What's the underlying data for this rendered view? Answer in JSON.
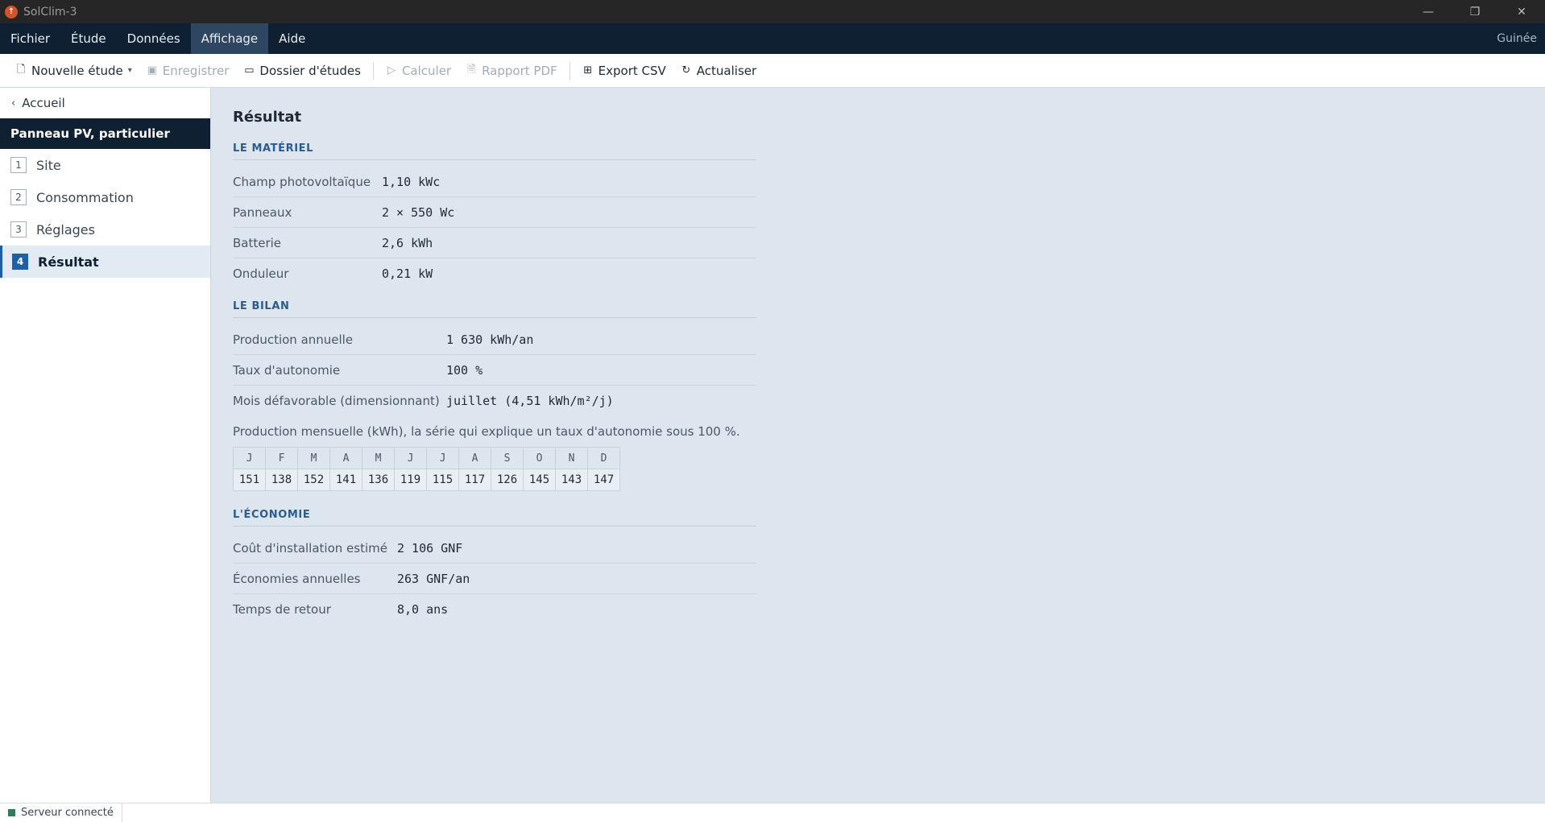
{
  "window": {
    "title": "SolClim-3",
    "icon": "sun-icon"
  },
  "menu": {
    "items": [
      "Fichier",
      "Étude",
      "Données",
      "Affichage",
      "Aide"
    ],
    "active": "Affichage",
    "region": "Guinée"
  },
  "toolbar": {
    "new_study": "Nouvelle étude",
    "save": "Enregistrer",
    "studies_folder": "Dossier d'études",
    "compute": "Calculer",
    "pdf_report": "Rapport PDF",
    "export_csv": "Export CSV",
    "refresh": "Actualiser"
  },
  "sidebar": {
    "back": "Accueil",
    "study_title": "Panneau PV, particulier",
    "steps": [
      {
        "num": "1",
        "label": "Site"
      },
      {
        "num": "2",
        "label": "Consommation"
      },
      {
        "num": "3",
        "label": "Réglages"
      },
      {
        "num": "4",
        "label": "Résultat"
      }
    ],
    "active_step": "4"
  },
  "main": {
    "title": "Résultat",
    "materiel": {
      "heading": "LE MATÉRIEL",
      "rows": [
        {
          "label": "Champ photovoltaïque",
          "value": "1,10 kWc"
        },
        {
          "label": "Panneaux",
          "value": "2 × 550 Wc"
        },
        {
          "label": "Batterie",
          "value": "2,6 kWh"
        },
        {
          "label": "Onduleur",
          "value": "0,21 kW"
        }
      ]
    },
    "bilan": {
      "heading": "LE BILAN",
      "rows": [
        {
          "label": "Production annuelle",
          "value": "1 630 kWh/an"
        },
        {
          "label": "Taux d'autonomie",
          "value": "100 %"
        },
        {
          "label": "Mois défavorable (dimensionnant)",
          "value": "juillet (4,51 kWh/m²/j)"
        }
      ],
      "monthly_note": "Production mensuelle (kWh), la série qui explique un taux d'autonomie sous 100 %.",
      "months": [
        "J",
        "F",
        "M",
        "A",
        "M",
        "J",
        "J",
        "A",
        "S",
        "O",
        "N",
        "D"
      ],
      "values": [
        "151",
        "138",
        "152",
        "141",
        "136",
        "119",
        "115",
        "117",
        "126",
        "145",
        "143",
        "147"
      ]
    },
    "economie": {
      "heading": "L'ÉCONOMIE",
      "rows": [
        {
          "label": "Coût d'installation estimé",
          "value": "2 106 GNF"
        },
        {
          "label": "Économies annuelles",
          "value": "263 GNF/an"
        },
        {
          "label": "Temps de retour",
          "value": "8,0 ans"
        }
      ]
    }
  },
  "status": {
    "server": "Serveur connecté",
    "color": "#2e7d5b"
  }
}
